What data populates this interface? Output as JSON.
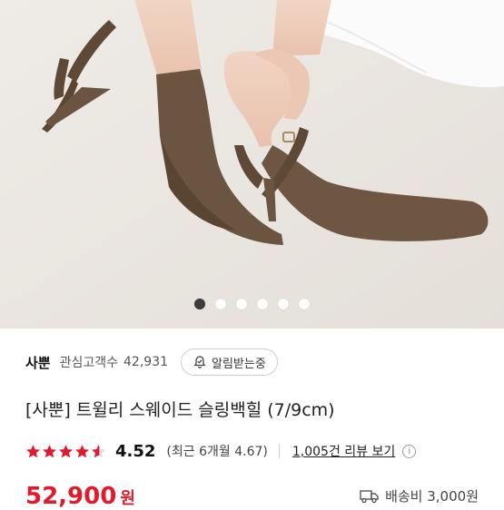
{
  "gallery": {
    "image_label": "product-photo",
    "page_count": 6,
    "active_index": 0
  },
  "store": {
    "name": "사뿐",
    "follow_label": "관심고객수",
    "follow_count": "42,931",
    "alarm_button": "알림받는중"
  },
  "product": {
    "title": "[사뿐] 트윌리 스웨이드 슬링백힐 (7/9cm)",
    "rating": "4.52",
    "rating_stars": 4.5,
    "recent_rating": "(최근 6개월 4.67)",
    "review_link": "1,005건 리뷰 보기",
    "price": "52,900",
    "currency": "원",
    "shipping": "배송비 3,000원"
  },
  "colors": {
    "accent": "#e11b2c",
    "star": "#e11b2c",
    "shoe": "#6b5440"
  }
}
